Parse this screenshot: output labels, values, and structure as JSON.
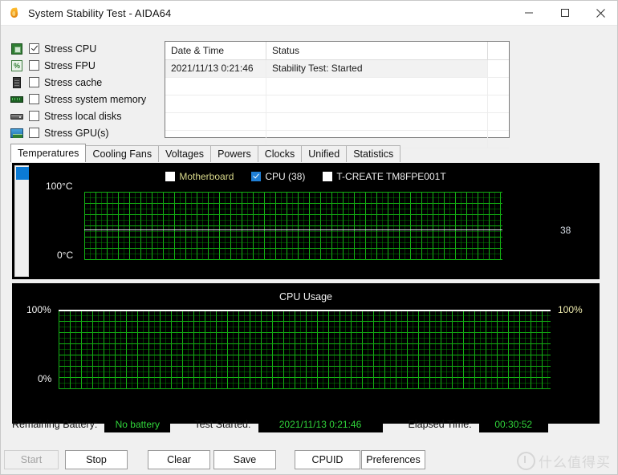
{
  "window": {
    "title": "System Stability Test - AIDA64",
    "app_icon": "flame-icon",
    "minimize_label": "Minimize",
    "maximize_label": "Maximize",
    "close_label": "Close"
  },
  "stress_options": [
    {
      "label": "Stress CPU",
      "checked": true,
      "icon": "cpu-icon"
    },
    {
      "label": "Stress FPU",
      "checked": false,
      "icon": "fpu-icon"
    },
    {
      "label": "Stress cache",
      "checked": false,
      "icon": "cache-icon"
    },
    {
      "label": "Stress system memory",
      "checked": false,
      "icon": "memory-icon"
    },
    {
      "label": "Stress local disks",
      "checked": false,
      "icon": "disk-icon"
    },
    {
      "label": "Stress GPU(s)",
      "checked": false,
      "icon": "gpu-icon"
    }
  ],
  "log": {
    "columns": [
      "Date & Time",
      "Status",
      ""
    ],
    "rows": [
      {
        "datetime": "2021/11/13 0:21:46",
        "status": "Stability Test: Started"
      }
    ]
  },
  "tabs": [
    {
      "label": "Temperatures",
      "active": true
    },
    {
      "label": "Cooling Fans",
      "active": false
    },
    {
      "label": "Voltages",
      "active": false
    },
    {
      "label": "Powers",
      "active": false
    },
    {
      "label": "Clocks",
      "active": false
    },
    {
      "label": "Unified",
      "active": false
    },
    {
      "label": "Statistics",
      "active": false
    }
  ],
  "temperature_chart": {
    "legend": [
      {
        "label": "Motherboard",
        "checked": false,
        "color": "#d9d98a"
      },
      {
        "label": "CPU (38)",
        "checked": true,
        "color": "#eeeeee"
      },
      {
        "label": "T-CREATE TM8FPE001T",
        "checked": false,
        "color": "#eeeeee"
      }
    ],
    "y_top_label": "100°C",
    "y_bottom_label": "0°C",
    "current_value_label": "38"
  },
  "usage_chart": {
    "title": "CPU Usage",
    "y_top_label": "100%",
    "y_bottom_label": "0%",
    "current_value_label": "100%"
  },
  "status": {
    "battery_label": "Remaining Battery:",
    "battery_value": "No battery",
    "started_label": "Test Started:",
    "started_value": "2021/11/13 0:21:46",
    "elapsed_label": "Elapsed Time:",
    "elapsed_value": "00:30:52"
  },
  "buttons": [
    {
      "label": "Start",
      "disabled": true
    },
    {
      "label": "Stop",
      "disabled": false
    },
    {
      "label": "Clear",
      "disabled": false
    },
    {
      "label": "Save",
      "disabled": false
    },
    {
      "label": "CPUID",
      "disabled": false
    },
    {
      "label": "Preferences",
      "disabled": false
    }
  ],
  "watermark": {
    "text": "什么值得买"
  },
  "chart_data": [
    {
      "type": "line",
      "title": "Temperatures",
      "ylabel": "°C",
      "ylim": [
        0,
        100
      ],
      "grid": true,
      "legend_position": "top-center",
      "series": [
        {
          "name": "Motherboard",
          "visible": false,
          "values": []
        },
        {
          "name": "CPU (38)",
          "visible": true,
          "current": 38,
          "values": [
            38,
            38,
            38,
            38,
            38,
            38,
            38,
            38,
            38,
            38,
            38,
            38,
            38,
            38,
            38,
            38,
            38,
            38,
            38,
            38,
            38,
            38,
            38,
            38,
            38,
            38,
            38,
            38,
            38,
            38,
            38,
            38,
            38,
            38,
            38,
            38,
            38,
            38,
            38,
            38
          ]
        },
        {
          "name": "T-CREATE TM8FPE001T",
          "visible": false,
          "values": []
        }
      ]
    },
    {
      "type": "line",
      "title": "CPU Usage",
      "ylabel": "%",
      "ylim": [
        0,
        100
      ],
      "grid": true,
      "series": [
        {
          "name": "CPU Usage",
          "visible": true,
          "current": 100,
          "values": [
            100,
            100,
            100,
            100,
            100,
            100,
            100,
            100,
            100,
            100,
            100,
            100,
            100,
            100,
            100,
            100,
            100,
            100,
            100,
            100,
            100,
            100,
            100,
            100,
            100,
            100,
            100,
            100,
            100,
            100,
            100,
            100,
            100,
            100,
            100,
            100,
            100,
            100,
            100,
            100
          ]
        }
      ]
    }
  ]
}
